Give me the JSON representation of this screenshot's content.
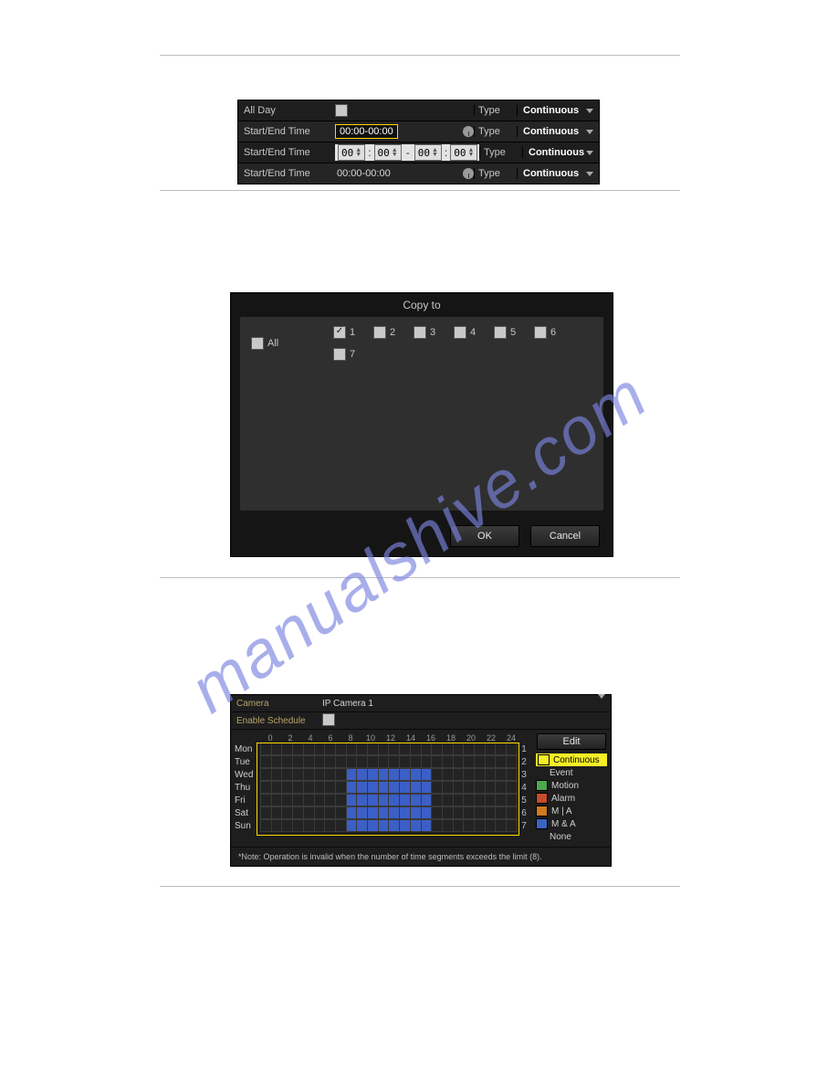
{
  "watermark_text": "manualshive.com",
  "section1": {
    "rows": [
      {
        "label": "All Day",
        "kind": "check",
        "checked": false,
        "type_label": "Type",
        "type_value": "Continuous"
      },
      {
        "label": "Start/End Time",
        "kind": "yellowbox",
        "time": "00:00-00:00",
        "clock": true,
        "type_label": "Type",
        "type_value": "Continuous"
      },
      {
        "label": "Start/End Time",
        "kind": "spinner",
        "hh1": "00",
        "mm1": "00",
        "hh2": "00",
        "mm2": "00",
        "type_label": "Type",
        "type_value": "Continuous"
      },
      {
        "label": "Start/End Time",
        "kind": "plain",
        "time": "00:00-00:00",
        "clock": true,
        "type_label": "Type",
        "type_value": "Continuous"
      }
    ]
  },
  "section2": {
    "title": "Copy to",
    "all_label": "All",
    "all_checked": false,
    "days": [
      {
        "label": "1",
        "checked": true
      },
      {
        "label": "2",
        "checked": false
      },
      {
        "label": "3",
        "checked": false
      },
      {
        "label": "4",
        "checked": false
      },
      {
        "label": "5",
        "checked": false
      },
      {
        "label": "6",
        "checked": false
      },
      {
        "label": "7",
        "checked": false
      }
    ],
    "ok": "OK",
    "cancel": "Cancel"
  },
  "section3": {
    "camera_label": "Camera",
    "camera_value": "IP Camera 1",
    "enable_label": "Enable Schedule",
    "enable_checked": false,
    "hours": [
      "0",
      "2",
      "4",
      "6",
      "8",
      "10",
      "12",
      "14",
      "16",
      "18",
      "20",
      "22",
      "24"
    ],
    "days": [
      {
        "name": "Mon",
        "num": "1",
        "range": null
      },
      {
        "name": "Tue",
        "num": "2",
        "range": null
      },
      {
        "name": "Wed",
        "num": "3",
        "range": [
          8,
          16
        ]
      },
      {
        "name": "Thu",
        "num": "4",
        "range": [
          8,
          16
        ]
      },
      {
        "name": "Fri",
        "num": "5",
        "range": [
          8,
          16
        ]
      },
      {
        "name": "Sat",
        "num": "6",
        "range": [
          8,
          16
        ]
      },
      {
        "name": "Sun",
        "num": "7",
        "range": [
          8,
          16
        ]
      }
    ],
    "edit": "Edit",
    "legend": [
      {
        "label": "Continuous",
        "color": "#f7ef26",
        "selected": true
      },
      {
        "label": "Event",
        "color": null
      },
      {
        "label": "Motion",
        "color": "#4ea64e"
      },
      {
        "label": "Alarm",
        "color": "#c34c2c"
      },
      {
        "label": "M | A",
        "color": "#cf7a20"
      },
      {
        "label": "M & A",
        "color": "#3a63c2"
      },
      {
        "label": "None",
        "color": null
      }
    ],
    "note": "*Note: Operation is invalid when the number of time segments exceeds the limit (8)."
  }
}
